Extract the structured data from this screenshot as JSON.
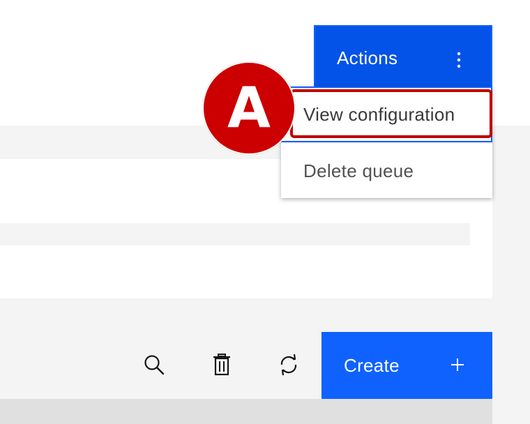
{
  "header": {
    "actions_label": "Actions",
    "overflow_icon": "overflow-menu-vertical-icon"
  },
  "actions_menu": {
    "items": [
      {
        "label": "View configuration",
        "focused": true
      },
      {
        "label": "Delete queue",
        "focused": false
      }
    ]
  },
  "annotation": {
    "badge_letter": "A",
    "badge_color": "#cc0000",
    "highlight_color": "#c00000"
  },
  "toolbar": {
    "icons": [
      "search-icon",
      "trash-can-icon",
      "renew-icon"
    ],
    "create_label": "Create",
    "create_icon": "add-icon"
  },
  "colors": {
    "primary": "#0f62fe",
    "primary_active": "#0353e9",
    "text_secondary": "#525252",
    "background_layer": "#f4f4f4"
  }
}
